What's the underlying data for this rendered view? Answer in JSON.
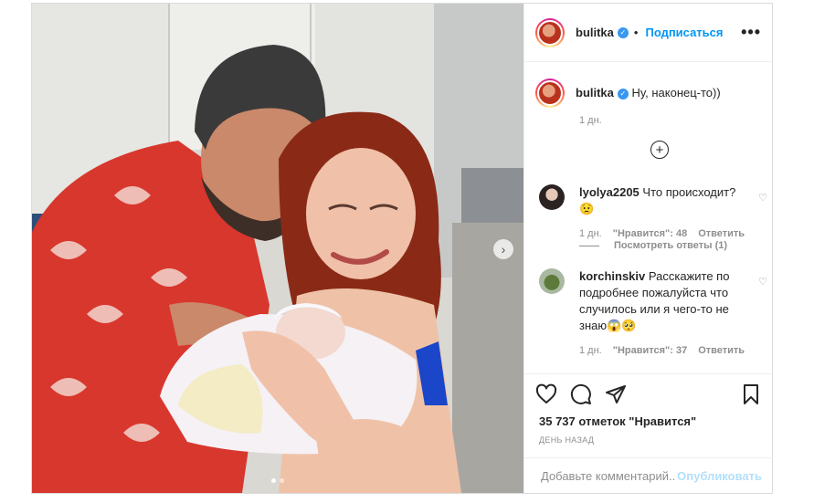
{
  "post": {
    "username": "bulitka",
    "follow_label": "Подписаться",
    "bullet": "•",
    "more": "•••",
    "caption": "Ну, наконец-то))",
    "caption_time": "1 дн.",
    "likes": "35 737 отметок \"Нравится\"",
    "date": "ДЕНЬ НАЗАД",
    "comment_placeholder": "Добавьте комментарий...",
    "publish_label": "Опубликовать"
  },
  "comments": [
    {
      "user": "lyolya2205",
      "text": "Что происходит? 😟",
      "time": "1 дн.",
      "likes": "\"Нравится\": 48",
      "reply": "Ответить",
      "view_replies": "Посмотреть ответы (1)"
    },
    {
      "user": "korchinskiv",
      "text": "Расскажите по подробнее пожалуйста что случилось или я чего-то не знаю😱🥺",
      "time": "1 дн.",
      "likes": "\"Нравится\": 37",
      "reply": "Ответить"
    }
  ],
  "icons": {
    "like": "heart-icon",
    "comment": "comment-icon",
    "share": "share-icon",
    "save": "bookmark-icon",
    "more": "more-icon",
    "add": "plus-circle-icon",
    "next": "chevron-right-icon"
  },
  "carousel": {
    "count": 2,
    "active": 1
  },
  "colors": {
    "accent": "#0095f6",
    "publish_disabled": "#b2dffc",
    "muted": "#8e8e8e"
  }
}
